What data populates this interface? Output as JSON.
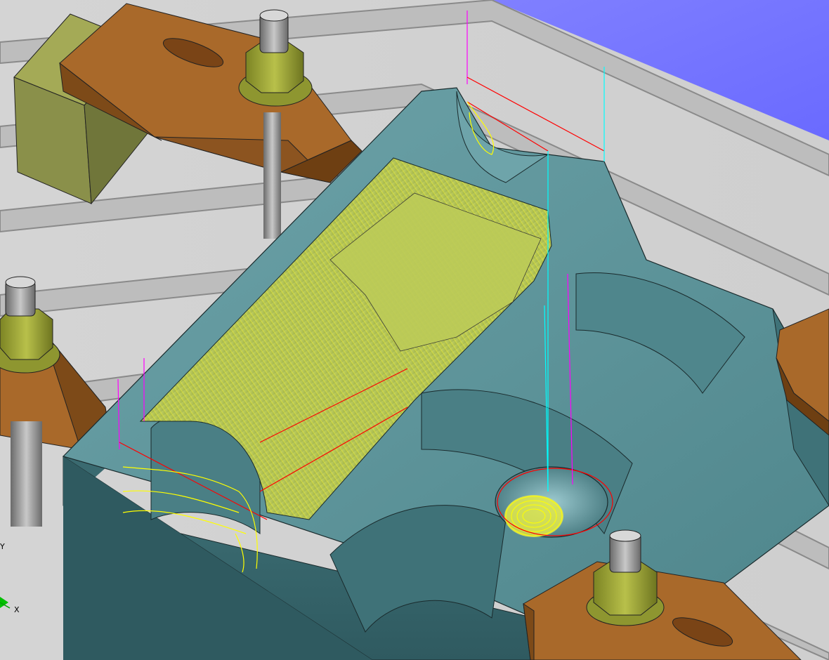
{
  "viewport": {
    "kind": "cam-3d-viewport",
    "background_color": "#cfcfcf",
    "background_gradient_corner_color": "#7373ff"
  },
  "scene": {
    "workpiece_color": "#5f969c",
    "machined_region_color": "#b9c85a",
    "toolpath_colors": [
      "#ffff00",
      "#ff0000",
      "#00ffff",
      "#ff00ff"
    ],
    "clamp_color": "#9a5a1c",
    "nut_color": "#9ea63a",
    "stud_color": "#9a9a9a",
    "fixture_block_color": "#8f944a"
  },
  "triad": {
    "y_label": "Y",
    "x_label": "X",
    "icons": [
      "axis-triad-icon"
    ]
  }
}
